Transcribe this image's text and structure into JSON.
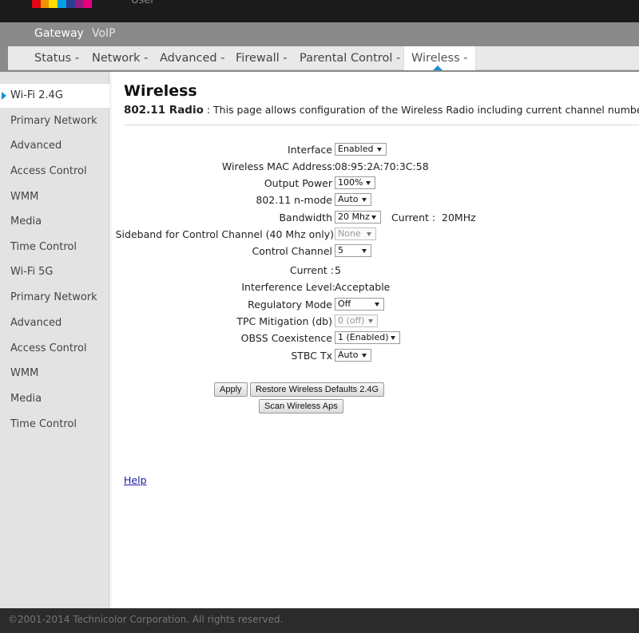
{
  "brand": {
    "user_label": "User",
    "logo_colors": [
      "#e30613",
      "#f39200",
      "#ffdd00",
      "#009fe3",
      "#2a3d8f",
      "#951b81",
      "#e6007e"
    ]
  },
  "main_nav": [
    "Gateway",
    "VoIP"
  ],
  "sub_nav": [
    "Status -",
    "Network -",
    "Advanced -",
    "Firewall -",
    "Parental Control -",
    "Wireless -"
  ],
  "sidebar": [
    "Wi-Fi 2.4G",
    "Primary Network",
    "Advanced",
    "Access Control",
    "WMM",
    "Media",
    "Time Control",
    "Wi-Fi 5G",
    "Primary Network",
    "Advanced",
    "Access Control",
    "WMM",
    "Media",
    "Time Control"
  ],
  "page": {
    "title": "Wireless",
    "subtitle_bold": "802.11 Radio",
    "subtitle_text": " : This page allows configuration of the Wireless Radio including current channel number"
  },
  "form": {
    "interface_label": "Interface",
    "interface_value": "Enabled",
    "mac_label": "Wireless MAC Address:",
    "mac_value": "08:95:2A:70:3C:58",
    "output_power_label": "Output Power",
    "output_power_value": "100%",
    "nmode_label": "802.11 n-mode",
    "nmode_value": "Auto",
    "bandwidth_label": "Bandwidth",
    "bandwidth_value": "20 Mhz",
    "bandwidth_current_label": "Current :",
    "bandwidth_current_value": "20MHz",
    "sideband_label": "Sideband for Control Channel (40 Mhz only)",
    "sideband_value": "None",
    "control_channel_label": "Control Channel",
    "control_channel_value": "5",
    "current_channel_label": "Current :",
    "current_channel_value": "5",
    "interference_label": "Interference Level:",
    "interference_value": "Acceptable",
    "regulatory_label": "Regulatory Mode",
    "regulatory_value": "Off",
    "tpc_label": "TPC Mitigation (db)",
    "tpc_value": "0 (off)",
    "obss_label": "OBSS Coexistence",
    "obss_value": "1 (Enabled)",
    "stbc_label": "STBC Tx",
    "stbc_value": "Auto"
  },
  "buttons": {
    "apply": "Apply",
    "restore": "Restore Wireless Defaults 2.4G",
    "scan": "Scan Wireless Aps"
  },
  "help_link": "Help",
  "footer": {
    "copyright": "©2001-2014 Technicolor Corporation. All rights reserved."
  },
  "colors": {
    "accent": "#1a8fd8",
    "header": "#1b1b1b",
    "nav_band": "#8a8a8a",
    "footer": "#2b2b2b"
  }
}
